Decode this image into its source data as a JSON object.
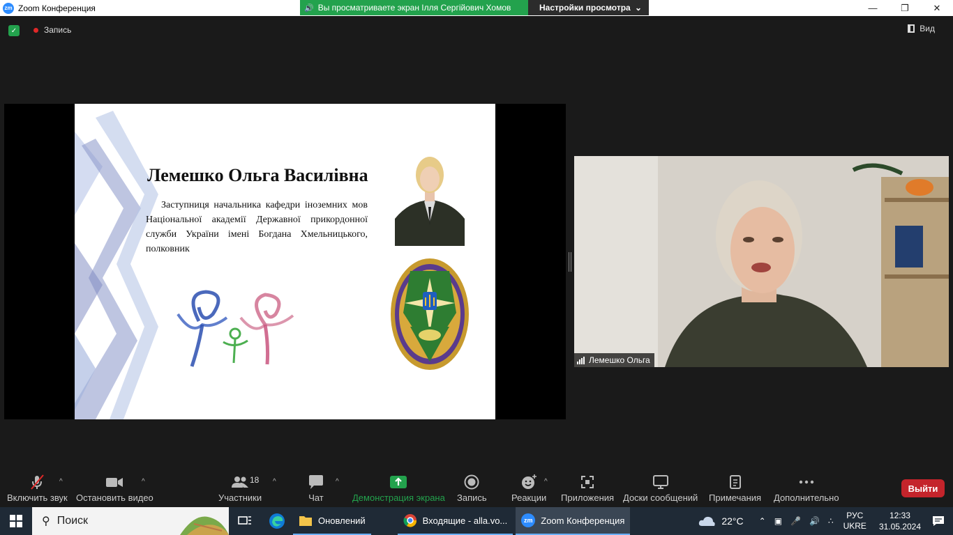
{
  "window": {
    "title": "Zoom Конференция",
    "app_icon_text": "zm",
    "controls": [
      "minimize-icon",
      "restore-icon",
      "close-icon"
    ]
  },
  "share_banner": {
    "viewing_text": "Вы просматриваете экран Ілля Сергійович Хомов",
    "settings_label": "Настройки просмотра"
  },
  "top_bar": {
    "recording_label": "Запись",
    "view_label": "Вид"
  },
  "slide": {
    "title": "Лемешко Ольга Василівна",
    "description": "Заступниця начальника кафедри іноземних мов Національної академії Державної прикордонної служби України імені Богдана Хмельницького, полковник"
  },
  "video": {
    "participant_name": "Лемешко Ольга"
  },
  "toolbar": {
    "unmute_label": "Включить звук",
    "stop_video_label": "Остановить видео",
    "participants_label": "Участники",
    "participants_count": "18",
    "chat_label": "Чат",
    "share_label": "Демонстрация экрана",
    "record_label": "Запись",
    "reactions_label": "Реакции",
    "apps_label": "Приложения",
    "whiteboards_label": "Доски сообщений",
    "notes_label": "Примечания",
    "more_label": "Дополнительно",
    "leave_label": "Выйти",
    "share_color": "#23a24d",
    "leave_color": "#c4242b"
  },
  "taskbar": {
    "search_placeholder": "Поиск",
    "tasks": [
      {
        "label": "Оновлений",
        "icon": "folder-icon"
      },
      {
        "label": "Входящие - alla.vo...",
        "icon": "chrome-icon"
      },
      {
        "label": "Zoom Конференция",
        "icon": "zoom-icon",
        "icon_text": "zm"
      }
    ],
    "weather": "22°C",
    "lang_top": "РУС",
    "lang_bottom": "UKRE",
    "time": "12:33",
    "date": "31.05.2024"
  }
}
